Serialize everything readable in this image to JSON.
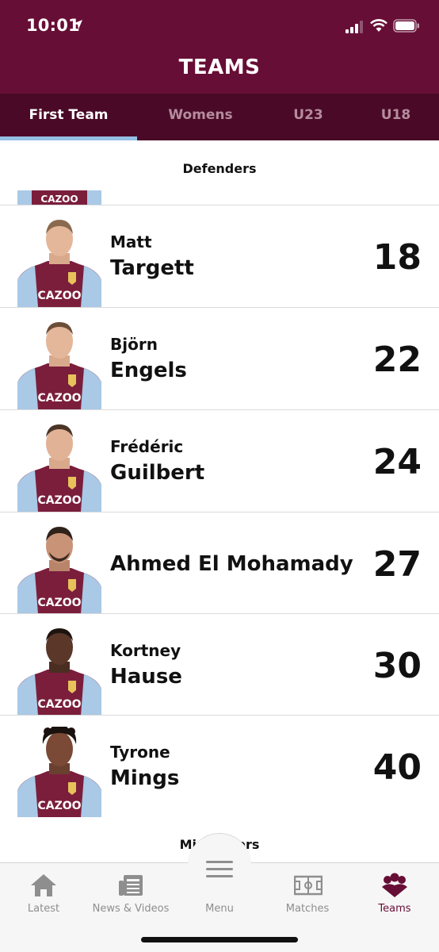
{
  "status": {
    "time": "10:01"
  },
  "header": {
    "title": "TEAMS"
  },
  "tabs": [
    {
      "label": "First Team",
      "active": true
    },
    {
      "label": "Womens",
      "active": false
    },
    {
      "label": "U23",
      "active": false
    },
    {
      "label": "U18",
      "active": false
    }
  ],
  "sections": {
    "defenders": "Defenders",
    "midfielders": "Midfielders"
  },
  "players": [
    {
      "first": "Matt",
      "last": "Targett",
      "number": "18"
    },
    {
      "first": "Björn",
      "last": "Engels",
      "number": "22"
    },
    {
      "first": "Frédéric",
      "last": "Guilbert",
      "number": "24"
    },
    {
      "full": "Ahmed El Mohamady",
      "number": "27"
    },
    {
      "first": "Kortney",
      "last": "Hause",
      "number": "30"
    },
    {
      "first": "Tyrone",
      "last": "Mings",
      "number": "40"
    }
  ],
  "kit": {
    "sponsor": "CAZOO"
  },
  "nav": [
    {
      "label": "Latest",
      "icon": "home-icon"
    },
    {
      "label": "News & Videos",
      "icon": "news-icon"
    },
    {
      "label": "Menu",
      "icon": "hamburger-icon"
    },
    {
      "label": "Matches",
      "icon": "pitch-icon"
    },
    {
      "label": "Teams",
      "icon": "team-icon",
      "active": true
    }
  ],
  "colors": {
    "claret": "#670E36",
    "claret_dark": "#4A0A27",
    "sky": "#95BFE5",
    "inactive_tab": "#B58C9D",
    "nav_grey": "#8E8E8E"
  }
}
